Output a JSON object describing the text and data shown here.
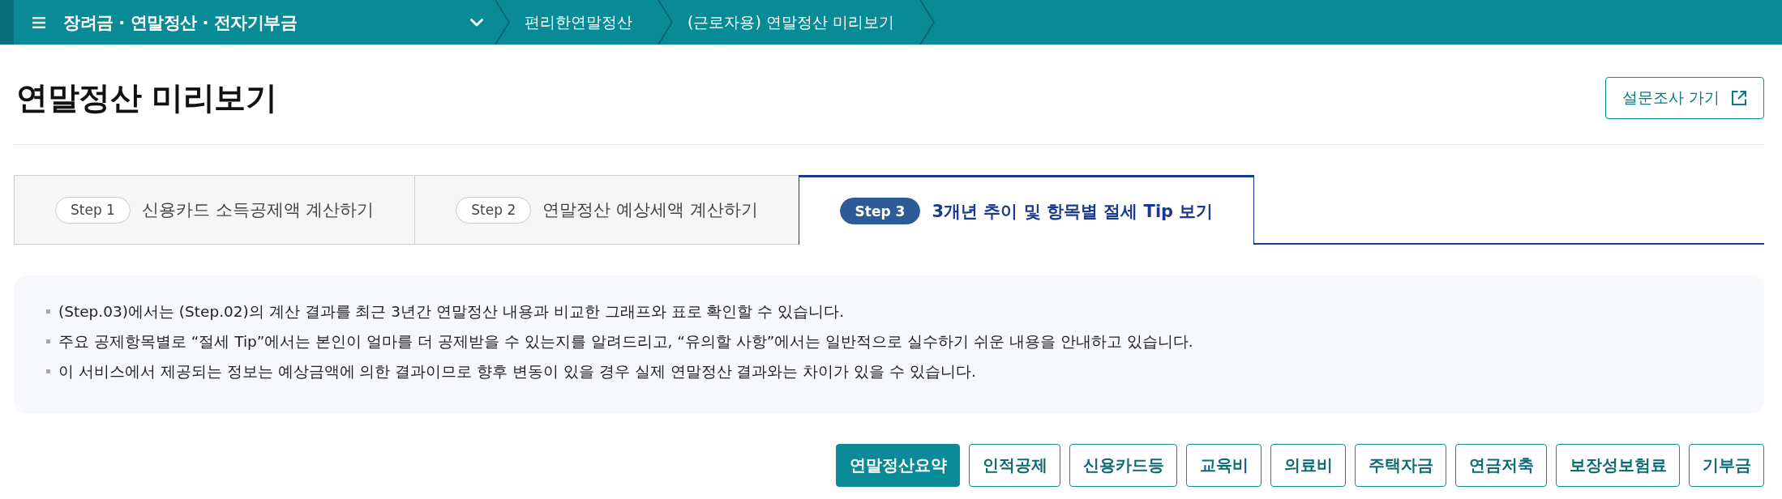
{
  "top_bar": {
    "title": "장려금 · 연말정산 · 전자기부금",
    "breadcrumbs": [
      "편리한연말정산",
      "(근로자용) 연말정산 미리보기"
    ]
  },
  "header": {
    "title": "연말정산 미리보기",
    "survey_button": "설문조사 가기"
  },
  "steps": [
    {
      "badge": "Step 1",
      "label": "신용카드 소득공제액 계산하기",
      "selected": false
    },
    {
      "badge": "Step 2",
      "label": "연말정산 예상세액 계산하기",
      "selected": false
    },
    {
      "badge": "Step 3",
      "label": "3개년 추이 및 항목별 절세 Tip 보기",
      "selected": true
    }
  ],
  "notes": [
    "(Step.03)에서는 (Step.02)의 계산 결과를 최근 3년간 연말정산 내용과 비교한 그래프와 표로 확인할 수 있습니다.",
    "주요 공제항목별로 “절세 Tip”에서는 본인이 얼마를 더 공제받을 수 있는지를 알려드리고, “유의할 사항”에서는 일반적으로 실수하기 쉬운 내용을 안내하고 있습니다.",
    "이 서비스에서 제공되는 정보는 예상금액에 의한 결과이므로 향후 변동이 있을 경우 실제 연말정산 결과와는 차이가 있을 수 있습니다."
  ],
  "categories": [
    {
      "label": "연말정산요약",
      "selected": true
    },
    {
      "label": "인적공제",
      "selected": false
    },
    {
      "label": "신용카드등",
      "selected": false
    },
    {
      "label": "교육비",
      "selected": false
    },
    {
      "label": "의료비",
      "selected": false
    },
    {
      "label": "주택자금",
      "selected": false
    },
    {
      "label": "연금저축",
      "selected": false
    },
    {
      "label": "보장성보험료",
      "selected": false
    },
    {
      "label": "기부금",
      "selected": false
    }
  ]
}
